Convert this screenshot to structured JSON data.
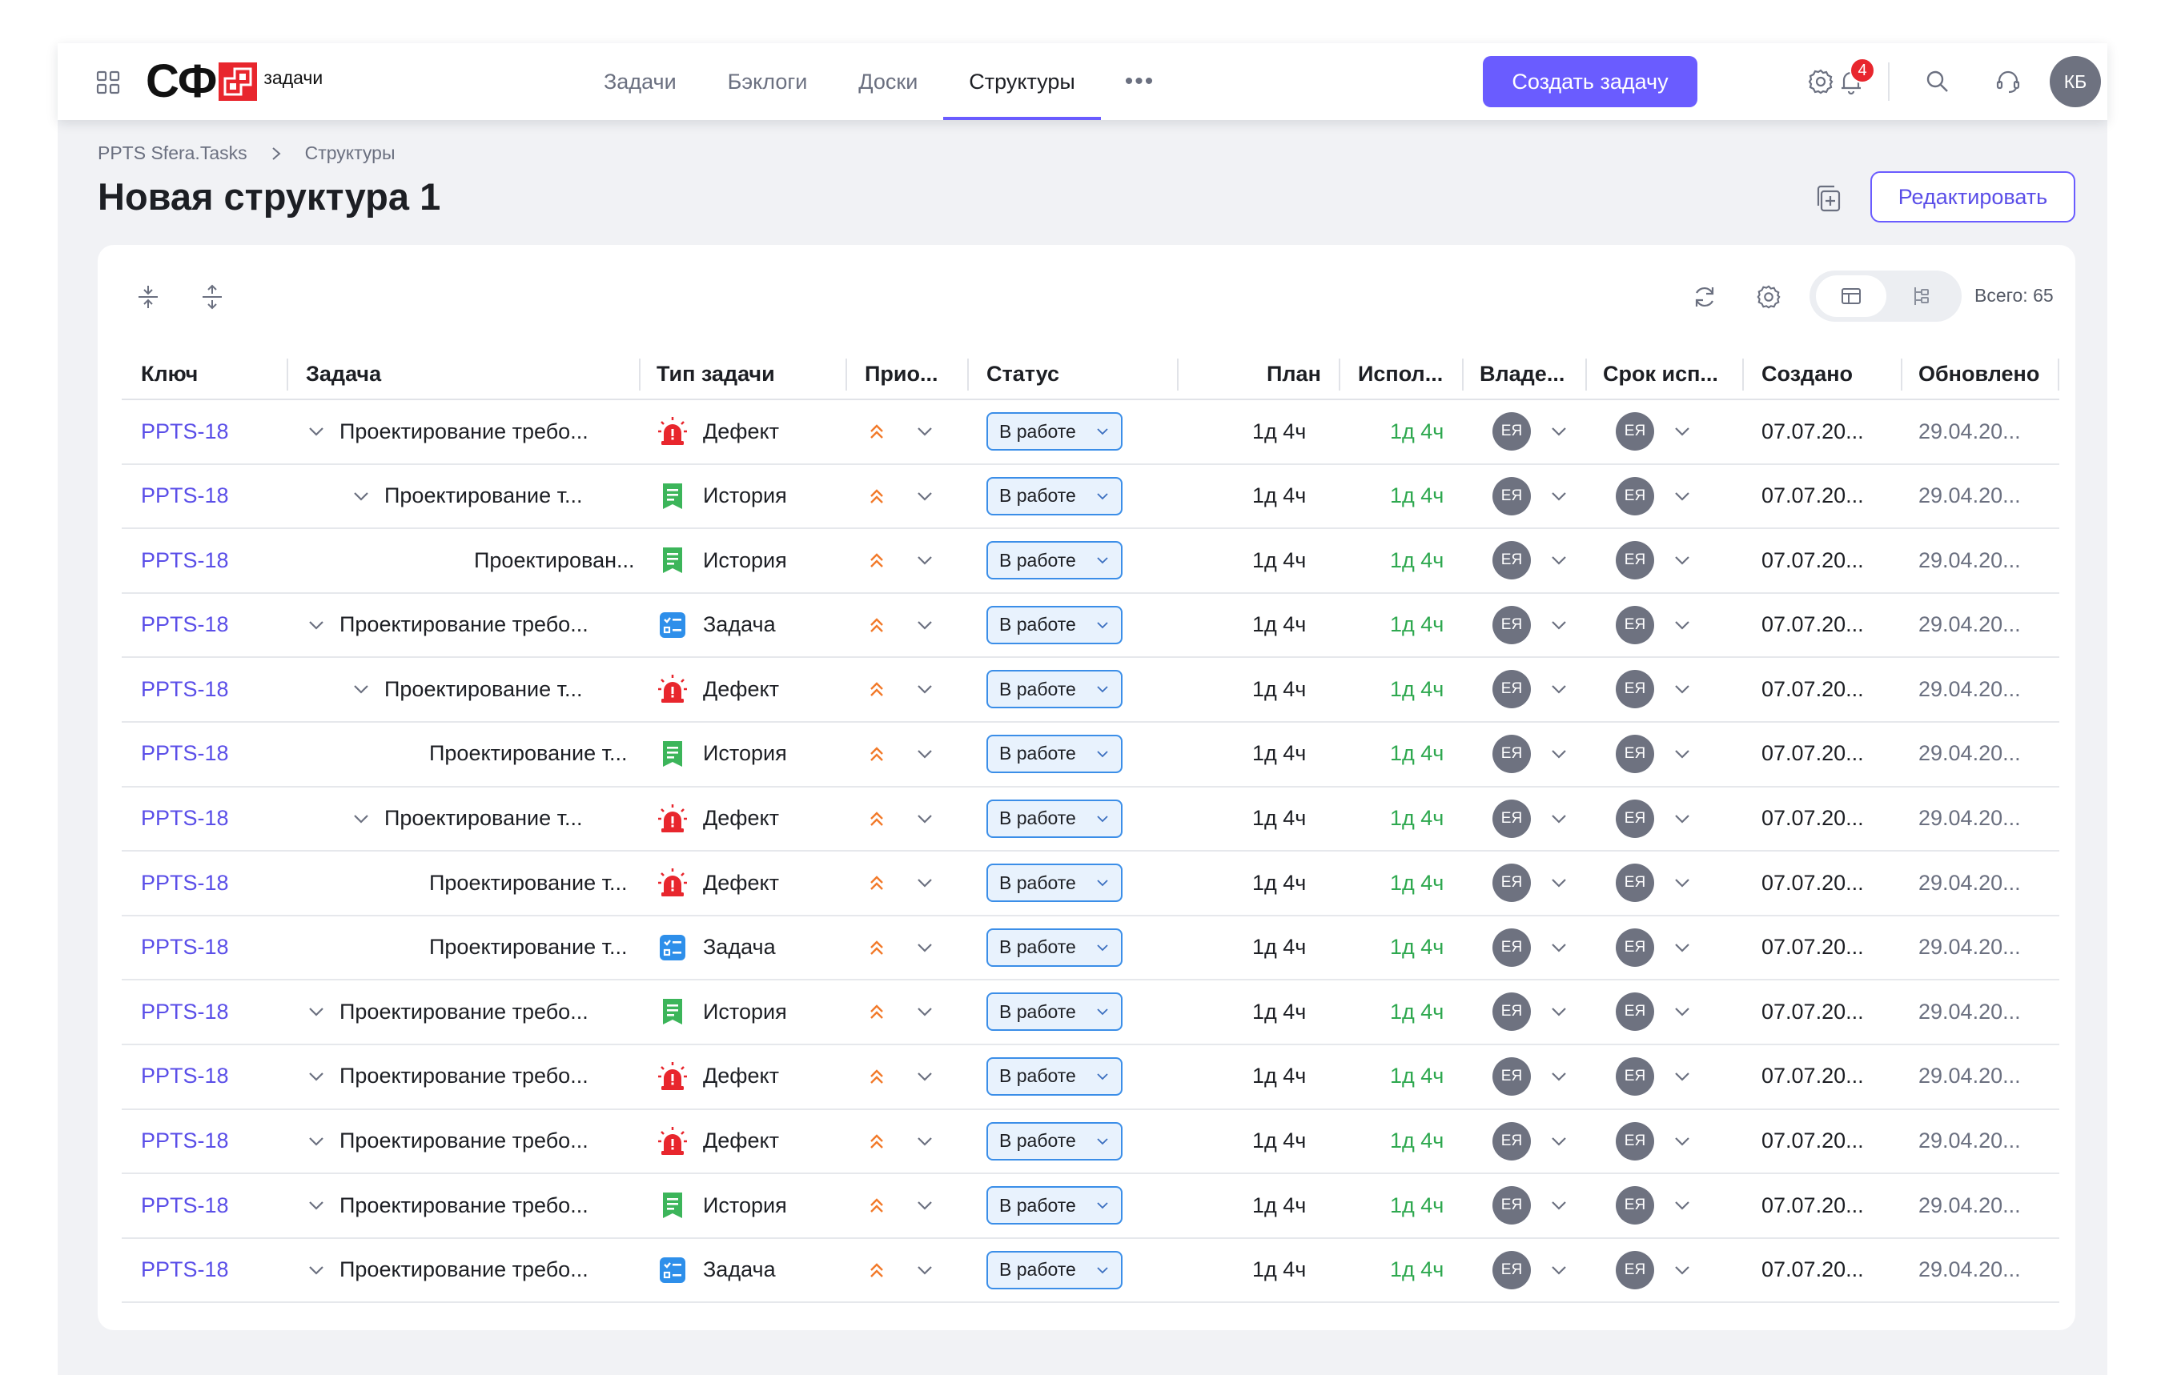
{
  "header": {
    "logo_text": "СФ",
    "logo_sub": "задачи",
    "nav": [
      "Задачи",
      "Бэклоги",
      "Доски",
      "Структуры"
    ],
    "nav_active_index": 3,
    "nav_more": "•••",
    "create_button": "Создать задачу",
    "notifications_count": "4",
    "user_initials": "КБ",
    "accent_color": "#6a5cff"
  },
  "breadcrumb": {
    "root": "PPTS Sfera.Tasks",
    "current": "Структуры"
  },
  "page_title": "Новая структура 1",
  "edit_button": "Редактировать",
  "toolbar": {
    "total": "Всего: 65"
  },
  "table": {
    "columns": {
      "key": "Ключ",
      "task": "Задача",
      "type": "Тип задачи",
      "priority": "Прио...",
      "status": "Статус",
      "plan": "План",
      "spent": "Испол...",
      "owner": "Владе...",
      "due": "Срок исп...",
      "created": "Создано",
      "updated": "Обновлено"
    },
    "rows": [
      {
        "key": "PPTS-18",
        "level": 0,
        "expand": true,
        "title": "Проектирование требо...",
        "type": "Дефект",
        "status": "В работе",
        "plan": "1д 4ч",
        "spent": "1д 4ч",
        "owner": "ЕЯ",
        "due": "ЕЯ",
        "created": "07.07.20...",
        "updated": "29.04.20..."
      },
      {
        "key": "PPTS-18",
        "level": 1,
        "expand": true,
        "title": "Проектирование т...",
        "type": "История",
        "status": "В работе",
        "plan": "1д 4ч",
        "spent": "1д 4ч",
        "owner": "ЕЯ",
        "due": "ЕЯ",
        "created": "07.07.20...",
        "updated": "29.04.20..."
      },
      {
        "key": "PPTS-18",
        "level": 2,
        "expand": false,
        "title": "Проектирован...",
        "type": "История",
        "status": "В работе",
        "plan": "1д 4ч",
        "spent": "1д 4ч",
        "owner": "ЕЯ",
        "due": "ЕЯ",
        "created": "07.07.20...",
        "updated": "29.04.20..."
      },
      {
        "key": "PPTS-18",
        "level": 0,
        "expand": true,
        "title": "Проектирование требо...",
        "type": "Задача",
        "status": "В работе",
        "plan": "1д 4ч",
        "spent": "1д 4ч",
        "owner": "ЕЯ",
        "due": "ЕЯ",
        "created": "07.07.20...",
        "updated": "29.04.20..."
      },
      {
        "key": "PPTS-18",
        "level": 1,
        "expand": true,
        "title": "Проектирование т...",
        "type": "Дефект",
        "status": "В работе",
        "plan": "1д 4ч",
        "spent": "1д 4ч",
        "owner": "ЕЯ",
        "due": "ЕЯ",
        "created": "07.07.20...",
        "updated": "29.04.20..."
      },
      {
        "key": "PPTS-18",
        "level": 1,
        "expand": false,
        "title": "Проектирование т...",
        "type": "История",
        "status": "В работе",
        "plan": "1д 4ч",
        "spent": "1д 4ч",
        "owner": "ЕЯ",
        "due": "ЕЯ",
        "created": "07.07.20...",
        "updated": "29.04.20..."
      },
      {
        "key": "PPTS-18",
        "level": 1,
        "expand": true,
        "title": "Проектирование т...",
        "type": "Дефект",
        "status": "В работе",
        "plan": "1д 4ч",
        "spent": "1д 4ч",
        "owner": "ЕЯ",
        "due": "ЕЯ",
        "created": "07.07.20...",
        "updated": "29.04.20..."
      },
      {
        "key": "PPTS-18",
        "level": 1,
        "expand": false,
        "title": "Проектирование т...",
        "type": "Дефект",
        "status": "В работе",
        "plan": "1д 4ч",
        "spent": "1д 4ч",
        "owner": "ЕЯ",
        "due": "ЕЯ",
        "created": "07.07.20...",
        "updated": "29.04.20..."
      },
      {
        "key": "PPTS-18",
        "level": 1,
        "expand": false,
        "title": "Проектирование т...",
        "type": "Задача",
        "status": "В работе",
        "plan": "1д 4ч",
        "spent": "1д 4ч",
        "owner": "ЕЯ",
        "due": "ЕЯ",
        "created": "07.07.20...",
        "updated": "29.04.20..."
      },
      {
        "key": "PPTS-18",
        "level": 0,
        "expand": true,
        "title": "Проектирование требо...",
        "type": "История",
        "status": "В работе",
        "plan": "1д 4ч",
        "spent": "1д 4ч",
        "owner": "ЕЯ",
        "due": "ЕЯ",
        "created": "07.07.20...",
        "updated": "29.04.20..."
      },
      {
        "key": "PPTS-18",
        "level": 0,
        "expand": true,
        "title": "Проектирование требо...",
        "type": "Дефект",
        "status": "В работе",
        "plan": "1д 4ч",
        "spent": "1д 4ч",
        "owner": "ЕЯ",
        "due": "ЕЯ",
        "created": "07.07.20...",
        "updated": "29.04.20..."
      },
      {
        "key": "PPTS-18",
        "level": 0,
        "expand": true,
        "title": "Проектирование требо...",
        "type": "Дефект",
        "status": "В работе",
        "plan": "1д 4ч",
        "spent": "1д 4ч",
        "owner": "ЕЯ",
        "due": "ЕЯ",
        "created": "07.07.20...",
        "updated": "29.04.20..."
      },
      {
        "key": "PPTS-18",
        "level": 0,
        "expand": true,
        "title": "Проектирование требо...",
        "type": "История",
        "status": "В работе",
        "plan": "1д 4ч",
        "spent": "1д 4ч",
        "owner": "ЕЯ",
        "due": "ЕЯ",
        "created": "07.07.20...",
        "updated": "29.04.20..."
      },
      {
        "key": "PPTS-18",
        "level": 0,
        "expand": true,
        "title": "Проектирование требо...",
        "type": "Задача",
        "status": "В работе",
        "plan": "1д 4ч",
        "spent": "1д 4ч",
        "owner": "ЕЯ",
        "due": "ЕЯ",
        "created": "07.07.20...",
        "updated": "29.04.20..."
      }
    ]
  }
}
